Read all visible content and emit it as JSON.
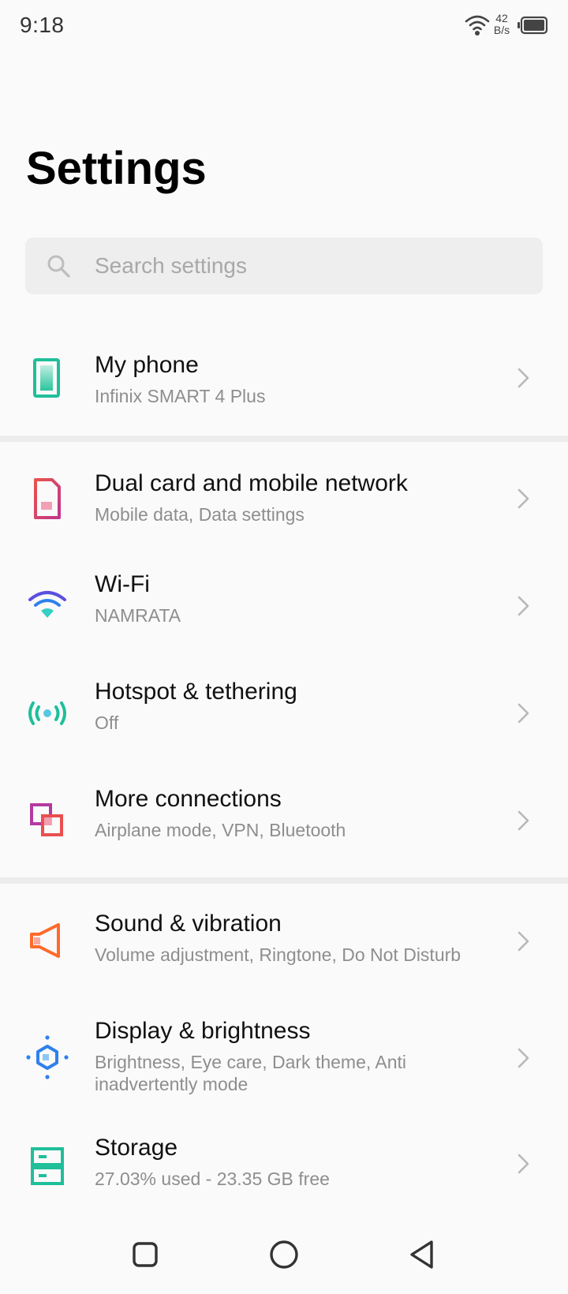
{
  "status_bar": {
    "time": "9:18",
    "net_speed_value": "42",
    "net_speed_unit": "B/s",
    "icons": [
      "wifi-icon",
      "battery-icon"
    ]
  },
  "page": {
    "title": "Settings"
  },
  "search": {
    "placeholder": "Search settings",
    "icon": "search-icon"
  },
  "items": [
    {
      "title": "My phone",
      "subtitle": "Infinix SMART 4 Plus",
      "icon": "phone-icon"
    },
    {
      "title": "Dual card and mobile network",
      "subtitle": "Mobile data, Data settings",
      "icon": "sim-card-icon"
    },
    {
      "title": "Wi-Fi",
      "subtitle": "NAMRATA",
      "icon": "wifi-icon"
    },
    {
      "title": "Hotspot & tethering",
      "subtitle": "Off",
      "icon": "hotspot-icon"
    },
    {
      "title": "More connections",
      "subtitle": "Airplane mode, VPN, Bluetooth",
      "icon": "connections-icon"
    },
    {
      "title": "Sound & vibration",
      "subtitle": "Volume adjustment, Ringtone, Do Not Disturb",
      "icon": "speaker-icon"
    },
    {
      "title": "Display & brightness",
      "subtitle": "Brightness, Eye care, Dark theme, Anti inadvertently mode",
      "icon": "brightness-icon"
    },
    {
      "title": "Storage",
      "subtitle": "27.03% used - 23.35 GB free",
      "icon": "storage-icon"
    }
  ],
  "nav_bar": {
    "buttons": [
      "recents-button",
      "home-button",
      "back-button"
    ]
  },
  "colors": {
    "background": "#fafafa",
    "divider": "#ececec",
    "subtitle": "#8e8e8e",
    "search_bg": "#eeeeee",
    "accent_teal": "#1fbf9a",
    "accent_pink": "#d63384",
    "accent_orange": "#ff6a2b",
    "accent_blue": "#2f80ed"
  }
}
